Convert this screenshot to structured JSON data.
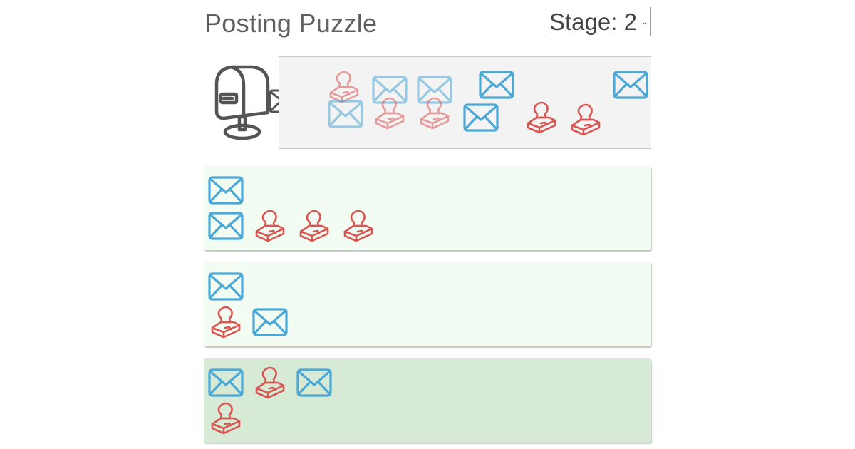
{
  "header": {
    "title": "Posting Puzzle",
    "stage_label": "Stage: 2"
  },
  "colors": {
    "envelope": "#4ca8d6",
    "stamp": "#d95552",
    "row_background": "#f3fcf2",
    "row_active_background": "#d6ead6",
    "pool_background": "#f3f3f3",
    "mailbox": "#555555"
  },
  "icons": {
    "mailbox": "mailbox-icon",
    "outgoing": "envelope-check-icon",
    "envelope": "envelope-icon",
    "stamp": "stamp-icon"
  },
  "pool": {
    "items": [
      "stamp",
      "envelope",
      "envelope",
      "envelope",
      "stamp",
      "stamp",
      "envelope",
      "stamp",
      "stamp",
      "envelope",
      "envelope"
    ]
  },
  "rows": [
    {
      "active": false,
      "lines": [
        [
          "envelope"
        ],
        [
          "envelope",
          "stamp",
          "stamp",
          "stamp"
        ]
      ]
    },
    {
      "active": false,
      "lines": [
        [
          "envelope"
        ],
        [
          "stamp",
          "envelope"
        ]
      ]
    },
    {
      "active": true,
      "lines": [
        [
          "envelope",
          "stamp",
          "envelope"
        ],
        [
          "stamp"
        ]
      ]
    }
  ]
}
